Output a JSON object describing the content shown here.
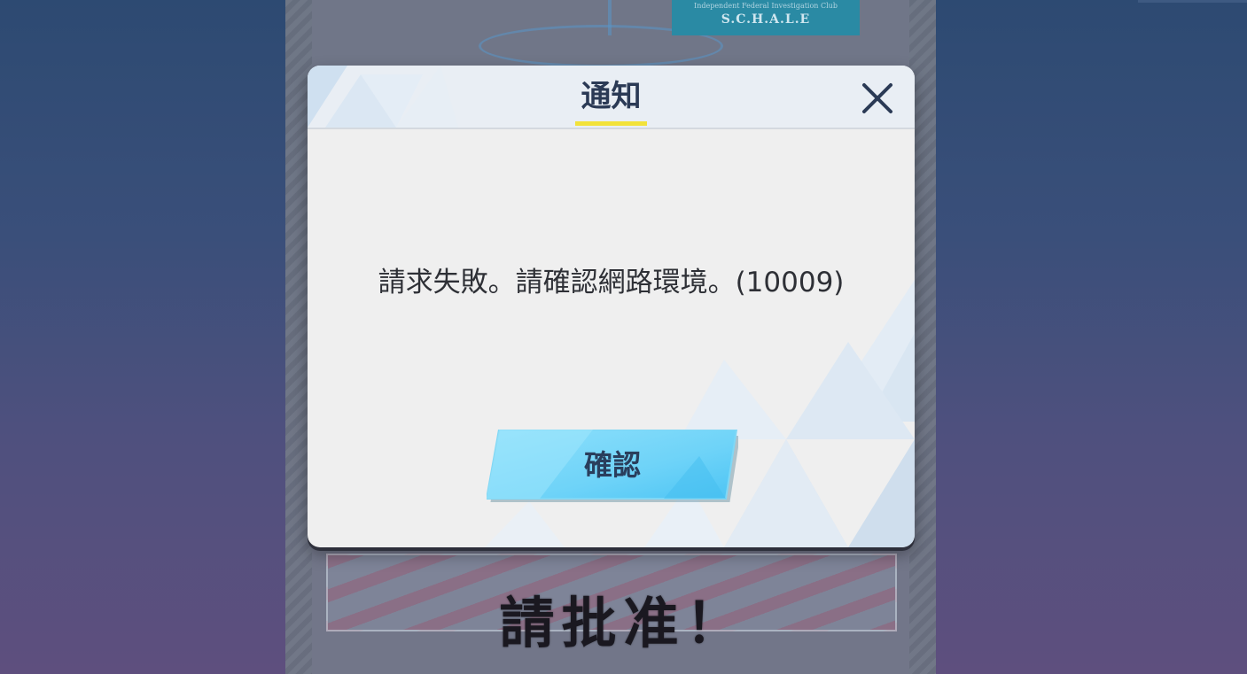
{
  "background": {
    "badge_subtitle": "Independent Federal Investigation Club",
    "badge_title": "S.C.H.A.L.E",
    "caption": "請批准！"
  },
  "dialog": {
    "title": "通知",
    "message": "請求失敗。請確認網路環境。(10009)",
    "confirm_label": "確認",
    "close_icon": "close-icon"
  },
  "colors": {
    "title_underline": "#f2e23a",
    "button_fill": "#6fd3f8",
    "title_text": "#2b3a55"
  }
}
